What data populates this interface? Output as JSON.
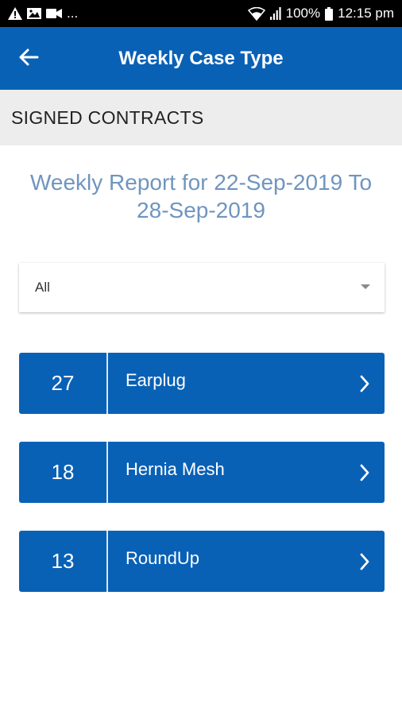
{
  "status_bar": {
    "left_more": "...",
    "battery_text": "100%",
    "time": "12:15 pm",
    "icons": [
      "warning-icon",
      "image-icon",
      "video-icon",
      "wifi-icon",
      "signal-icon",
      "battery-icon"
    ]
  },
  "app_bar": {
    "title": "Weekly Case Type",
    "back_icon": "arrow-left-icon"
  },
  "section": {
    "title": "SIGNED CONTRACTS"
  },
  "report": {
    "title_line1": "Weekly Report for 22-Sep-2019 To",
    "title_line2": "28-Sep-2019"
  },
  "filter": {
    "selected": "All"
  },
  "cases": [
    {
      "count": "27",
      "name": "Earplug"
    },
    {
      "count": "18",
      "name": "Hernia Mesh"
    },
    {
      "count": "13",
      "name": "RoundUp"
    }
  ],
  "colors": {
    "primary": "#0961b6",
    "section_bg": "#ededed",
    "report_title": "#6f95bf",
    "status_bar": "#000000"
  }
}
